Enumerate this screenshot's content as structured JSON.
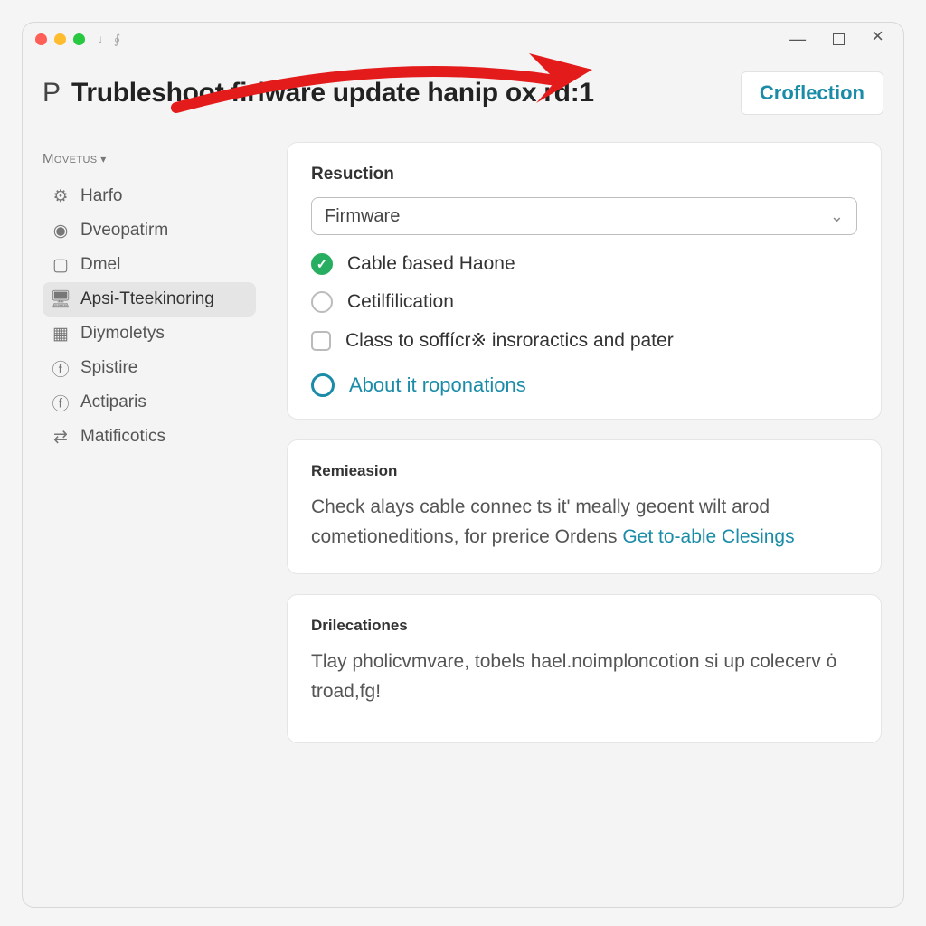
{
  "window": {
    "prefix": "P",
    "title": "Trubleshoot firiware update hanip ox rd:1",
    "action_button": "Croflection"
  },
  "sidebar": {
    "header": "Movetus",
    "items": [
      {
        "icon": "robot-icon",
        "label": "Harfo"
      },
      {
        "icon": "shield-icon",
        "label": "Dveopatirm"
      },
      {
        "icon": "doc-icon",
        "label": "Dmel"
      },
      {
        "icon": "monitor-icon",
        "label": "Apsi-Tteekinoring"
      },
      {
        "icon": "grid-icon",
        "label": "Diymoletys"
      },
      {
        "icon": "circle-f-icon",
        "label": "Spistire"
      },
      {
        "icon": "circle-f-icon",
        "label": "Actiparis"
      },
      {
        "icon": "swap-icon",
        "label": "Matificotics"
      }
    ],
    "active_index": 3
  },
  "main": {
    "resuction": {
      "label": "Resuction",
      "select_value": "Firmware",
      "options": [
        {
          "kind": "radio-on",
          "text": "Cable ɓased Haone"
        },
        {
          "kind": "radio",
          "text": "Cetilfilication"
        },
        {
          "kind": "checkbox",
          "text": "Class to soffícr※ insroractics and pater"
        }
      ],
      "about_link": "About it roponations"
    },
    "remeasion": {
      "label": "Remieasion",
      "body_prefix": "Check alays cable connec ts it' meally geoent wilt arod cometioneditions, for prerice Ordens ",
      "body_link": "Get to-able Clesings"
    },
    "directions": {
      "label": "Drilecationes",
      "body": "Tlay pholicvmvare, tobels hael.noimploncotion si up colecerv ȯ troad,fg!"
    }
  }
}
